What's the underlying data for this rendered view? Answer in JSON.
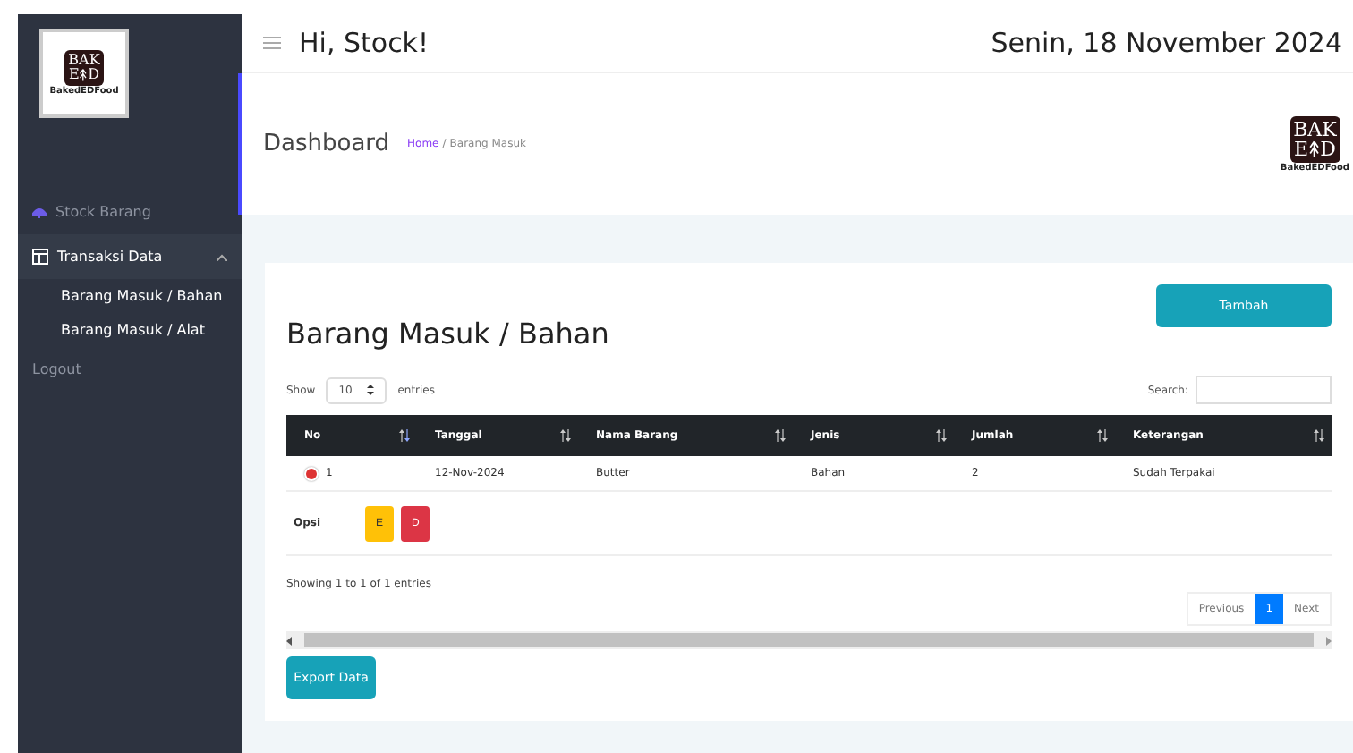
{
  "sidebar": {
    "logo": {
      "top": "BAK",
      "bottom_left": "E",
      "bottom_right": "D",
      "caption": "BakedEDFood"
    },
    "items": [
      {
        "label": "Stock Barang",
        "selected": false
      },
      {
        "label": "Transaksi Data",
        "expanded": true,
        "selected": true,
        "children": [
          {
            "label": "Barang Masuk / Bahan"
          },
          {
            "label": "Barang Masuk / Alat"
          }
        ]
      },
      {
        "label": "Logout",
        "selected": false
      }
    ]
  },
  "header": {
    "greeting": "Hi, Stock!",
    "date": "Senin, 18 November 2024"
  },
  "subheader": {
    "title": "Dashboard",
    "breadcrumb": [
      {
        "label": "Home",
        "link": true
      },
      {
        "label": "/",
        "link": false
      },
      {
        "label": "Barang Masuk",
        "link": false
      }
    ],
    "logo": {
      "top": "BAK",
      "bottom_left": "E",
      "bottom_right": "D",
      "caption": "BakedEDFood"
    }
  },
  "card": {
    "title": "Barang Masuk / Bahan",
    "add_button": "Tambah",
    "length": {
      "before": "Show",
      "value": "10",
      "after": "entries"
    },
    "search_label": "Search:",
    "columns": [
      {
        "label": "No",
        "sorted": true
      },
      {
        "label": "Tanggal",
        "sorted": false
      },
      {
        "label": "Nama Barang",
        "sorted": false
      },
      {
        "label": "Jenis",
        "sorted": false
      },
      {
        "label": "Jumlah",
        "sorted": false
      },
      {
        "label": "Keterangan",
        "sorted": false
      }
    ],
    "rows": [
      {
        "expanded": true,
        "cells": [
          "1",
          "12-Nov-2024",
          "Butter",
          "Bahan",
          "2",
          "Sudah Terpakai"
        ],
        "detail": {
          "label": "Opsi",
          "buttons": [
            {
              "label": "E",
              "kind": "edit"
            },
            {
              "label": "D",
              "kind": "delete"
            }
          ]
        }
      }
    ],
    "info": "Showing 1 to 1 of 1 entries",
    "pagination": [
      {
        "label": "Previous",
        "selected": false
      },
      {
        "label": "1",
        "selected": true
      },
      {
        "label": "Next",
        "selected": false
      }
    ],
    "export_button": "Export Data"
  }
}
